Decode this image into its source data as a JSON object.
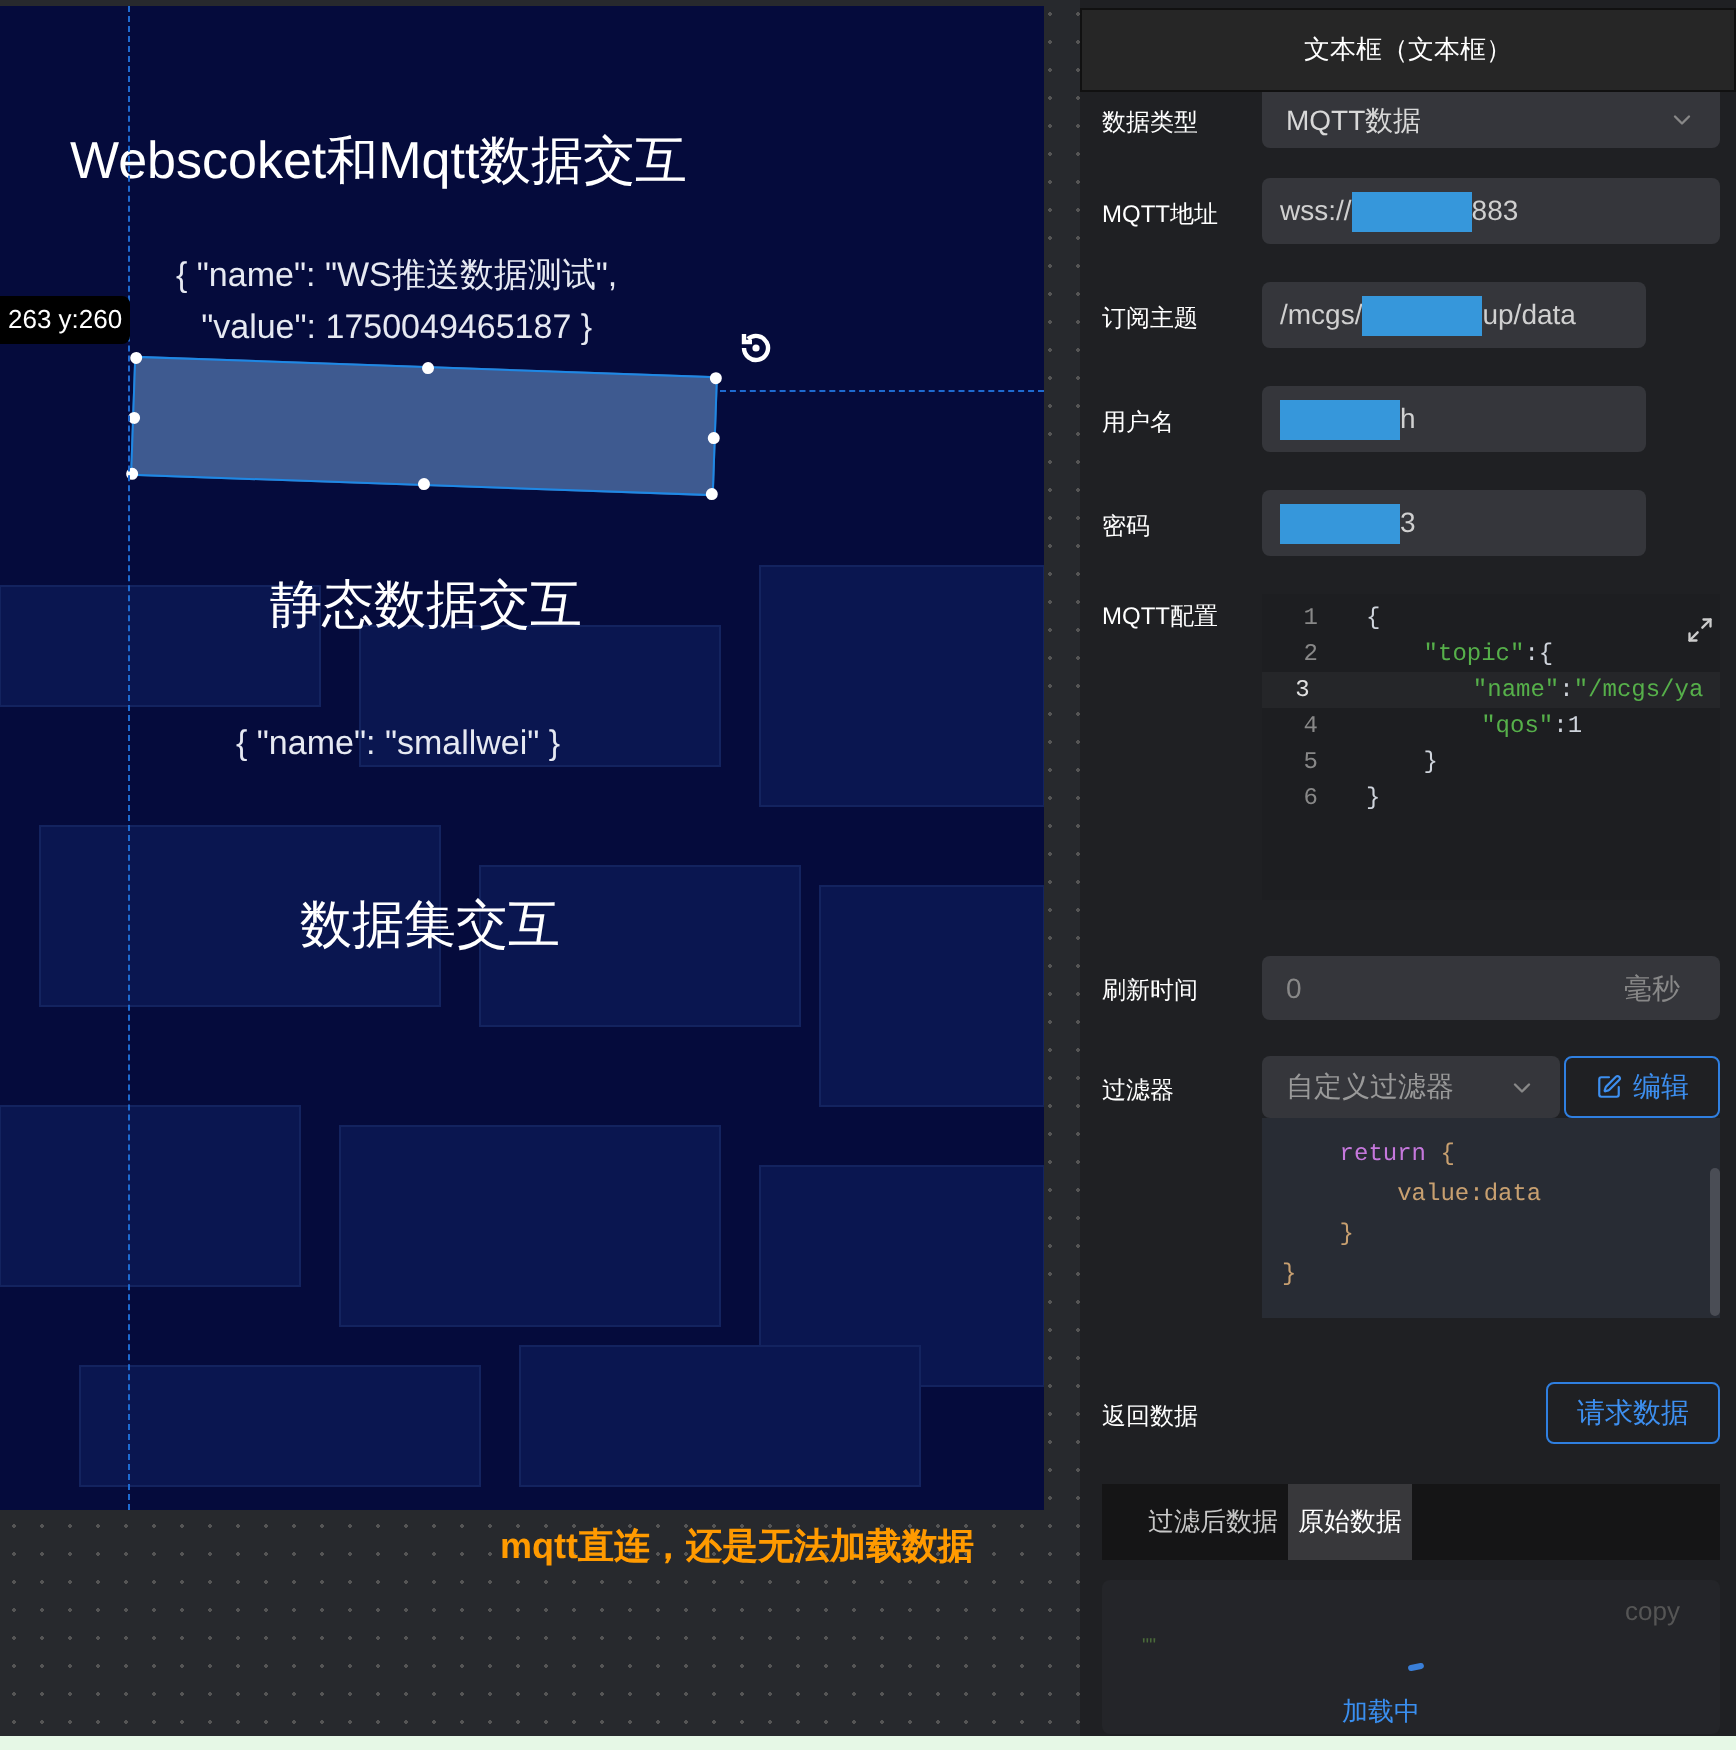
{
  "canvas": {
    "coord_tooltip": "263 y:260",
    "texts": [
      {
        "kind": "title",
        "text": "Webscoket和Mqtt数据交互"
      },
      {
        "kind": "json",
        "lines": [
          "{ \"name\": \"WS推送数据测试\",",
          "\"value\": 1750049465187 }"
        ]
      },
      {
        "kind": "selected_box"
      },
      {
        "kind": "title",
        "text": "静态数据交互"
      },
      {
        "kind": "json",
        "lines": [
          "{ \"name\": \"smallwei\" }"
        ]
      },
      {
        "kind": "title",
        "text": "数据集交互"
      }
    ],
    "annotation": "mqtt直连，还是无法加载数据"
  },
  "panel": {
    "title": "文本框（文本框）",
    "fields": [
      {
        "kind": "select",
        "label": "数据类型",
        "value": "MQTT数据"
      },
      {
        "kind": "redacted",
        "label": "MQTT地址",
        "prefix": "wss://",
        "suffix": "883",
        "wide": true
      },
      {
        "kind": "redacted",
        "label": "订阅主题",
        "prefix": "/mcgs/",
        "suffix": "up/data",
        "wide": false
      },
      {
        "kind": "redacted",
        "label": "用户名",
        "suffix": "h",
        "wide": false
      },
      {
        "kind": "redacted",
        "label": "密码",
        "suffix": "3",
        "wide": false
      },
      {
        "kind": "code",
        "label": "MQTT配置",
        "lines": [
          {
            "number": "1",
            "active": false,
            "tokens": [
              {
                "t": "{",
                "color": "#cfd4dc"
              }
            ]
          },
          {
            "number": "2",
            "active": false,
            "tokens": [
              {
                "t": "    \"topic\"",
                "color": "#56b04a"
              },
              {
                "t": ":{",
                "color": "#cfd4dc"
              }
            ]
          },
          {
            "number": "3",
            "active": true,
            "tokens": [
              {
                "t": "        \"name\"",
                "color": "#56b04a"
              },
              {
                "t": ":",
                "color": "#cfd4dc"
              },
              {
                "t": "\"/mcgs/ya",
                "color": "#56b04a"
              }
            ]
          },
          {
            "number": "4",
            "active": false,
            "tokens": [
              {
                "t": "        \"qos\"",
                "color": "#56b04a"
              },
              {
                "t": ":1",
                "color": "#cfd4dc"
              }
            ]
          },
          {
            "number": "5",
            "active": false,
            "tokens": [
              {
                "t": "    }",
                "color": "#cfd4dc"
              }
            ]
          },
          {
            "number": "6",
            "active": false,
            "tokens": [
              {
                "t": "}",
                "color": "#cfd4dc"
              }
            ]
          }
        ]
      },
      {
        "kind": "suffix_input",
        "label": "刷新时间",
        "placeholder": "0",
        "suffix": "毫秒"
      },
      {
        "kind": "select_button",
        "label": "过滤器",
        "value": "自定义过滤器",
        "button": "编辑"
      },
      {
        "kind": "filter_code",
        "lines": [
          [
            {
              "t": "    return",
              "color": "#c678dd"
            },
            {
              "t": " {",
              "color": "#c8a070"
            }
          ],
          [
            {
              "t": "        value:data",
              "color": "#c8a070"
            }
          ],
          [
            {
              "t": "    }",
              "color": "#c8a070"
            }
          ],
          [
            {
              "t": "}",
              "color": "#c8a070"
            }
          ]
        ]
      },
      {
        "kind": "action",
        "label": "返回数据",
        "button": "请求数据"
      }
    ],
    "tabs": [
      {
        "label": "过滤后数据",
        "selected": false
      },
      {
        "label": "原始数据",
        "selected": true
      }
    ],
    "output": {
      "copy": "copy",
      "content": "\"\"",
      "status": "加载中"
    }
  }
}
